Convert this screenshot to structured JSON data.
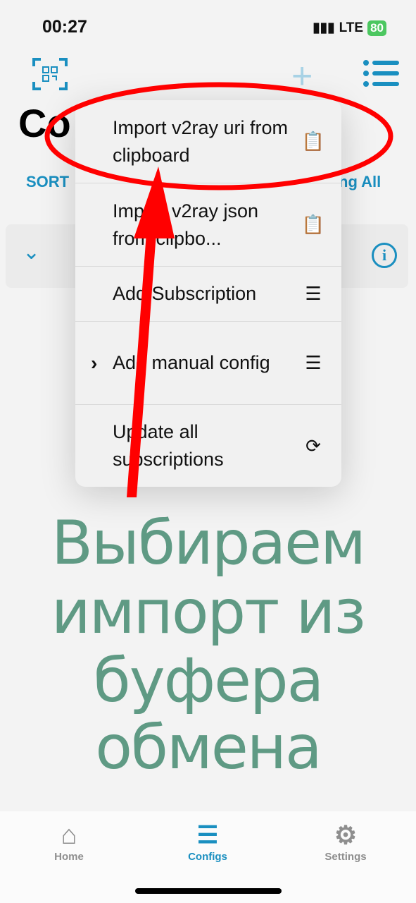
{
  "status": {
    "time": "00:27",
    "network": "LTE",
    "battery": "80"
  },
  "header": {
    "title": "Co",
    "sort": "SORT",
    "ping_all": "ng All"
  },
  "menu": {
    "items": [
      {
        "label": "Import v2ray uri from clipboard",
        "icon": "clipboard-icon"
      },
      {
        "label": "Import v2ray json from clipbo...",
        "icon": "clipboard-icon"
      },
      {
        "label": "Add Subscription",
        "icon": "list-icon"
      },
      {
        "label": "Add manual config",
        "icon": "list-icon",
        "has_submenu": true
      },
      {
        "label": "Update all subscriptions",
        "icon": "refresh-icon"
      }
    ]
  },
  "caption": [
    "Выбираем",
    "импорт из",
    "буфера",
    "обмена"
  ],
  "tabs": [
    {
      "label": "Home"
    },
    {
      "label": "Configs"
    },
    {
      "label": "Settings"
    }
  ],
  "colors": {
    "accent": "#1a8fc0",
    "annotation": "#ff0000",
    "caption": "#5f9a84"
  }
}
